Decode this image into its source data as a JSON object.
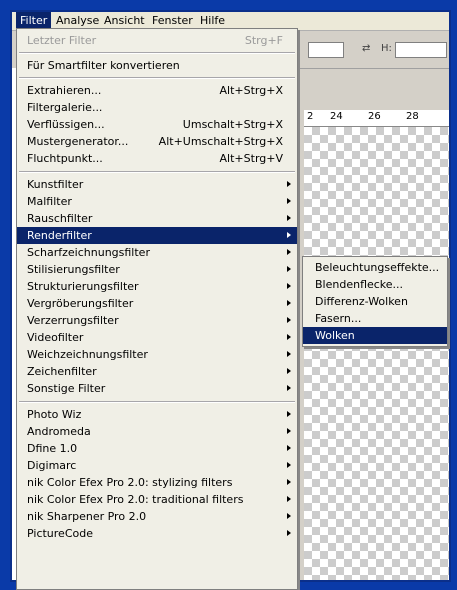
{
  "menubar": {
    "items": [
      "Filter",
      "Analyse",
      "Ansicht",
      "Fenster",
      "Hilfe"
    ],
    "active": "Filter"
  },
  "options_bar": {
    "h_label": "H:"
  },
  "ruler": {
    "ticks": [
      "2",
      "24",
      "26",
      "28"
    ]
  },
  "filter_menu": {
    "items": [
      {
        "label": "Letzter Filter",
        "shortcut": "Strg+F",
        "disabled": true
      },
      {
        "label": "Für Smartfilter konvertieren",
        "shortcut": ""
      },
      {
        "label": "Extrahieren...",
        "shortcut": "Alt+Strg+X"
      },
      {
        "label": "Filtergalerie...",
        "shortcut": ""
      },
      {
        "label": "Verflüssigen...",
        "shortcut": "Umschalt+Strg+X"
      },
      {
        "label": "Mustergenerator...",
        "shortcut": "Alt+Umschalt+Strg+X"
      },
      {
        "label": "Fluchtpunkt...",
        "shortcut": "Alt+Strg+V"
      },
      {
        "label": "Kunstfilter",
        "submenu": true
      },
      {
        "label": "Malfilter",
        "submenu": true
      },
      {
        "label": "Rauschfilter",
        "submenu": true
      },
      {
        "label": "Renderfilter",
        "submenu": true,
        "highlighted": true
      },
      {
        "label": "Scharfzeichnungsfilter",
        "submenu": true
      },
      {
        "label": "Stilisierungsfilter",
        "submenu": true
      },
      {
        "label": "Strukturierungsfilter",
        "submenu": true
      },
      {
        "label": "Vergröberungsfilter",
        "submenu": true
      },
      {
        "label": "Verzerrungsfilter",
        "submenu": true
      },
      {
        "label": "Videofilter",
        "submenu": true
      },
      {
        "label": "Weichzeichnungsfilter",
        "submenu": true
      },
      {
        "label": "Zeichenfilter",
        "submenu": true
      },
      {
        "label": "Sonstige Filter",
        "submenu": true
      },
      {
        "label": "Photo Wiz",
        "submenu": true
      },
      {
        "label": "Andromeda",
        "submenu": true
      },
      {
        "label": "Dfine 1.0",
        "submenu": true
      },
      {
        "label": "Digimarc",
        "submenu": true
      },
      {
        "label": "nik Color Efex Pro 2.0: stylizing filters",
        "submenu": true
      },
      {
        "label": "nik Color Efex Pro 2.0: traditional filters",
        "submenu": true
      },
      {
        "label": "nik Sharpener Pro 2.0",
        "submenu": true
      },
      {
        "label": "PictureCode",
        "submenu": true
      }
    ]
  },
  "render_submenu": {
    "items": [
      {
        "label": "Beleuchtungseffekte..."
      },
      {
        "label": "Blendenflecke..."
      },
      {
        "label": "Differenz-Wolken"
      },
      {
        "label": "Fasern..."
      },
      {
        "label": "Wolken",
        "highlighted": true
      }
    ]
  }
}
